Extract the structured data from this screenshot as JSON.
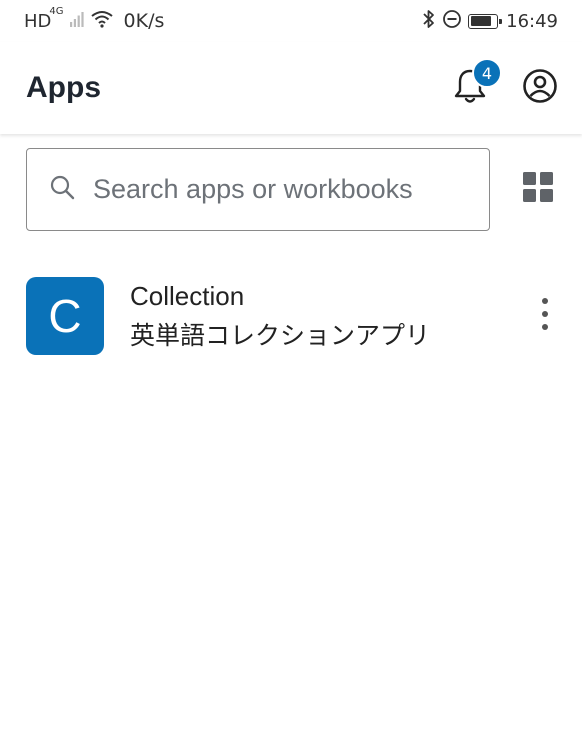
{
  "status_bar": {
    "network": "HD",
    "network_type": "4G",
    "speed": "0K/s",
    "time": "16:49",
    "icons": [
      "signal-icon",
      "wifi-icon",
      "bluetooth-icon",
      "dnd-icon",
      "battery-icon"
    ],
    "battery_level": 0.8
  },
  "header": {
    "title": "Apps",
    "notification_count": "4",
    "icons": [
      "bell-icon",
      "account-icon"
    ]
  },
  "search": {
    "placeholder": "Search apps or workbooks",
    "icons": [
      "search-icon",
      "grid-view-icon"
    ]
  },
  "apps": [
    {
      "initial": "C",
      "name": "Collection",
      "description": "英単語コレクションアプリ",
      "icon": "more-vert-icon"
    }
  ],
  "colors": {
    "accent": "#0a72b8",
    "title_text": "#1f2630",
    "placeholder": "#6d7278"
  }
}
